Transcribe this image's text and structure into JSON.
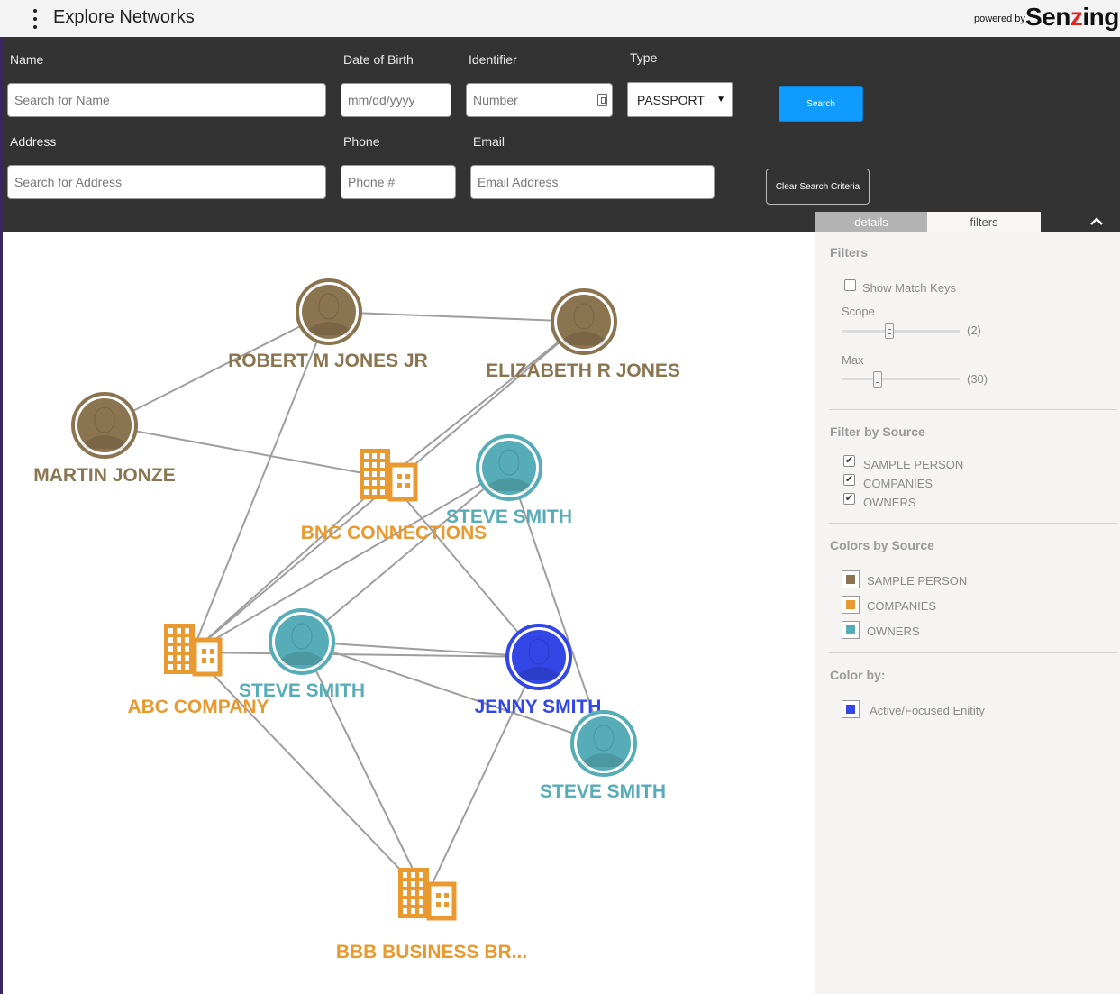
{
  "header": {
    "title": "Explore Networks",
    "powered_by": "powered by",
    "brand_prefix": "Sen",
    "brand_z": "z",
    "brand_suffix": "ing"
  },
  "search": {
    "name_label": "Name",
    "name_placeholder": "Search for Name",
    "dob_label": "Date of Birth",
    "dob_placeholder": "mm/dd/yyyy",
    "identifier_label": "Identifier",
    "identifier_placeholder": "Number",
    "type_label": "Type",
    "type_value": "PASSPORT",
    "address_label": "Address",
    "address_placeholder": "Search for Address",
    "phone_label": "Phone",
    "phone_placeholder": "Phone #",
    "email_label": "Email",
    "email_placeholder": "Email Address",
    "search_button": "Search",
    "clear_button": "Clear Search Criteria"
  },
  "tabs": {
    "details": "details",
    "filters": "filters"
  },
  "filters": {
    "title": "Filters",
    "show_match_keys": "Show Match Keys",
    "show_match_keys_checked": false,
    "scope_label": "Scope",
    "scope_value": "(2)",
    "scope_level": 0.4,
    "max_label": "Max",
    "max_value": "(30)",
    "max_level": 0.3
  },
  "filter_by_source": {
    "title": "Filter by Source",
    "items": [
      {
        "label": "SAMPLE PERSON",
        "checked": true
      },
      {
        "label": "COMPANIES",
        "checked": true
      },
      {
        "label": "OWNERS",
        "checked": true
      }
    ]
  },
  "colors_by_source": {
    "title": "Colors by Source",
    "items": [
      {
        "label": "SAMPLE PERSON",
        "color": "#8b7550"
      },
      {
        "label": "COMPANIES",
        "color": "#e89a31"
      },
      {
        "label": "OWNERS",
        "color": "#56adb8"
      }
    ]
  },
  "color_by": {
    "title": "Color by:",
    "items": [
      {
        "label": "Active/Focused Enitity",
        "color": "#3346e6"
      }
    ]
  },
  "colors": {
    "person": "#8b7550",
    "company": "#e89a31",
    "owner": "#56adb8",
    "focused": "#3346e6",
    "search_button": "#0f9bff",
    "panel": "#333333"
  },
  "graph": {
    "nodes": [
      {
        "id": "robert",
        "label": "ROBERT M JONES JR",
        "kind": "person",
        "icon": "person-icon"
      },
      {
        "id": "elizabeth",
        "label": "ELIZABETH R JONES",
        "kind": "person",
        "icon": "person-icon"
      },
      {
        "id": "martin",
        "label": "MARTIN JONZE",
        "kind": "person",
        "icon": "person-icon"
      },
      {
        "id": "bnc",
        "label": "BNC CONNECTIONS",
        "kind": "company",
        "icon": "building-icon"
      },
      {
        "id": "steve1",
        "label": "STEVE SMITH",
        "kind": "owner",
        "icon": "person-icon"
      },
      {
        "id": "abc",
        "label": "ABC COMPANY",
        "kind": "company",
        "icon": "building-icon"
      },
      {
        "id": "steve2",
        "label": "STEVE SMITH",
        "kind": "owner",
        "icon": "person-icon"
      },
      {
        "id": "jenny",
        "label": "JENNY SMITH",
        "kind": "focused",
        "icon": "person-icon"
      },
      {
        "id": "steve3",
        "label": "STEVE SMITH",
        "kind": "owner",
        "icon": "person-icon"
      },
      {
        "id": "bbb",
        "label": "BBB BUSINESS BR...",
        "kind": "company",
        "icon": "building-icon"
      }
    ],
    "edges": [
      [
        "robert",
        "elizabeth"
      ],
      [
        "robert",
        "martin"
      ],
      [
        "robert",
        "abc"
      ],
      [
        "elizabeth",
        "bnc"
      ],
      [
        "elizabeth",
        "abc"
      ],
      [
        "martin",
        "bnc"
      ],
      [
        "bnc",
        "jenny"
      ],
      [
        "bnc",
        "abc"
      ],
      [
        "steve1",
        "abc"
      ],
      [
        "steve1",
        "steve2"
      ],
      [
        "steve1",
        "steve3"
      ],
      [
        "abc",
        "jenny"
      ],
      [
        "abc",
        "bbb"
      ],
      [
        "steve2",
        "jenny"
      ],
      [
        "steve2",
        "bbb"
      ],
      [
        "jenny",
        "bbb"
      ],
      [
        "steve2",
        "steve3"
      ]
    ]
  }
}
